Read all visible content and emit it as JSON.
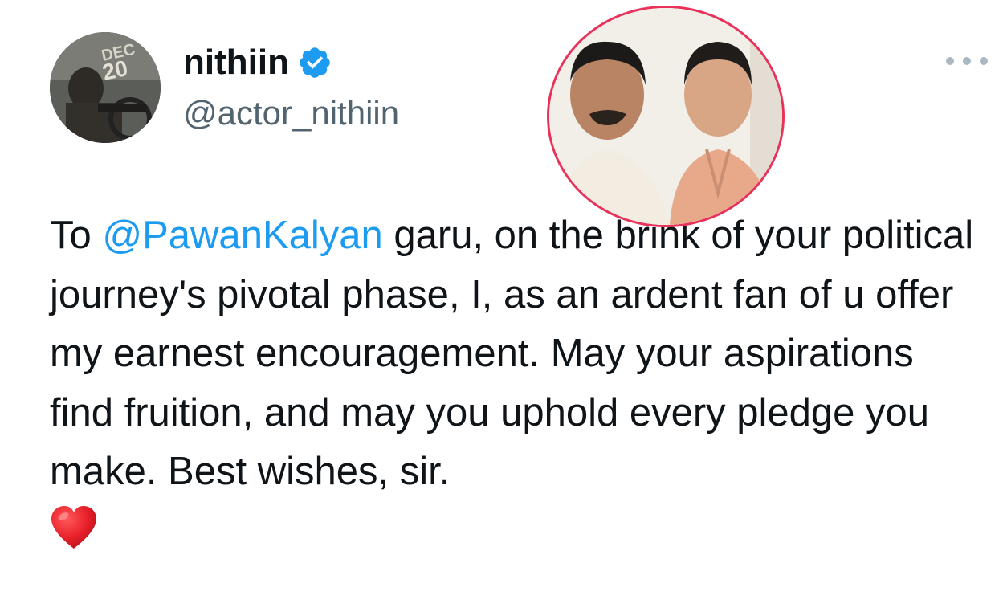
{
  "author": {
    "display_name": "nithiin",
    "handle": "@actor_nithiin",
    "verified": true,
    "avatar_badge": [
      "DEC",
      "20"
    ]
  },
  "tweet": {
    "prefix": "To ",
    "mention": "@PawanKalyan",
    "body": " garu, on the brink of your political journey's pivotal phase, I, as an ardent fan of u offer my earnest encouragement. May your aspirations find fruition, and may you uphold every pledge you make. Best wishes, sir.",
    "emoji": "red-heart"
  },
  "colors": {
    "mention": "#1d9bf0",
    "verified_badge": "#1d9bf0",
    "text": "#0f1419",
    "handle": "#536471",
    "photo_border": "#e8325a"
  },
  "icons": {
    "verified": "verified-badge-icon",
    "more": "more-options-icon",
    "emoji": "red-heart-icon"
  }
}
